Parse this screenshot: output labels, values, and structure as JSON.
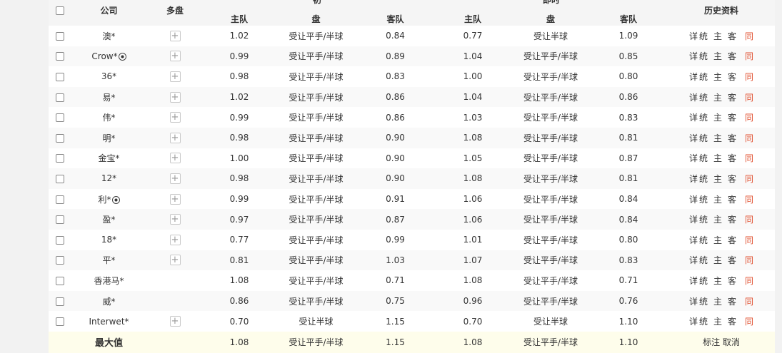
{
  "header": {
    "company": "公司",
    "multi": "多盘",
    "initial_group": "初",
    "live_group": "即时",
    "home": "主队",
    "pan": "盘",
    "away": "客队",
    "history": "历史资料"
  },
  "history_links": {
    "detail": "详",
    "stats": "统",
    "home": "主",
    "away": "客",
    "same": "同"
  },
  "colors": {
    "accent_same": "#e04b2a",
    "max_row_bg": "#fefdeb",
    "header_bg": "#f5f5f5"
  },
  "rows": [
    {
      "company": "澳*",
      "ball": false,
      "multi": true,
      "init_home": "1.02",
      "init_pan": "受让平手/半球",
      "init_away": "0.84",
      "live_home": "0.77",
      "live_pan": "受让半球",
      "live_away": "1.09"
    },
    {
      "company": "Crow*",
      "ball": true,
      "multi": true,
      "init_home": "0.99",
      "init_pan": "受让平手/半球",
      "init_away": "0.89",
      "live_home": "1.04",
      "live_pan": "受让平手/半球",
      "live_away": "0.85"
    },
    {
      "company": "36*",
      "ball": false,
      "multi": true,
      "init_home": "0.98",
      "init_pan": "受让平手/半球",
      "init_away": "0.83",
      "live_home": "1.00",
      "live_pan": "受让平手/半球",
      "live_away": "0.80"
    },
    {
      "company": "易*",
      "ball": false,
      "multi": true,
      "init_home": "1.02",
      "init_pan": "受让平手/半球",
      "init_away": "0.86",
      "live_home": "1.04",
      "live_pan": "受让平手/半球",
      "live_away": "0.86"
    },
    {
      "company": "伟*",
      "ball": false,
      "multi": true,
      "init_home": "0.99",
      "init_pan": "受让平手/半球",
      "init_away": "0.86",
      "live_home": "1.03",
      "live_pan": "受让平手/半球",
      "live_away": "0.83"
    },
    {
      "company": "明*",
      "ball": false,
      "multi": true,
      "init_home": "0.98",
      "init_pan": "受让平手/半球",
      "init_away": "0.90",
      "live_home": "1.08",
      "live_pan": "受让平手/半球",
      "live_away": "0.81"
    },
    {
      "company": "金宝*",
      "ball": false,
      "multi": true,
      "init_home": "1.00",
      "init_pan": "受让平手/半球",
      "init_away": "0.90",
      "live_home": "1.05",
      "live_pan": "受让平手/半球",
      "live_away": "0.87"
    },
    {
      "company": "12*",
      "ball": false,
      "multi": true,
      "init_home": "0.98",
      "init_pan": "受让平手/半球",
      "init_away": "0.90",
      "live_home": "1.08",
      "live_pan": "受让平手/半球",
      "live_away": "0.81"
    },
    {
      "company": "利*",
      "ball": true,
      "multi": true,
      "init_home": "0.99",
      "init_pan": "受让平手/半球",
      "init_away": "0.91",
      "live_home": "1.06",
      "live_pan": "受让平手/半球",
      "live_away": "0.84"
    },
    {
      "company": "盈*",
      "ball": false,
      "multi": true,
      "init_home": "0.97",
      "init_pan": "受让平手/半球",
      "init_away": "0.87",
      "live_home": "1.06",
      "live_pan": "受让平手/半球",
      "live_away": "0.84"
    },
    {
      "company": "18*",
      "ball": false,
      "multi": true,
      "init_home": "0.77",
      "init_pan": "受让平手/半球",
      "init_away": "0.99",
      "live_home": "1.01",
      "live_pan": "受让平手/半球",
      "live_away": "0.80"
    },
    {
      "company": "平*",
      "ball": false,
      "multi": true,
      "init_home": "0.81",
      "init_pan": "受让平手/半球",
      "init_away": "1.03",
      "live_home": "1.07",
      "live_pan": "受让平手/半球",
      "live_away": "0.83"
    },
    {
      "company": "香港马*",
      "ball": false,
      "multi": false,
      "init_home": "1.08",
      "init_pan": "受让平手/半球",
      "init_away": "0.71",
      "live_home": "1.08",
      "live_pan": "受让平手/半球",
      "live_away": "0.71"
    },
    {
      "company": "威*",
      "ball": false,
      "multi": false,
      "init_home": "0.86",
      "init_pan": "受让平手/半球",
      "init_away": "0.75",
      "live_home": "0.96",
      "live_pan": "受让平手/半球",
      "live_away": "0.76"
    },
    {
      "company": "Interwet*",
      "ball": false,
      "multi": true,
      "init_home": "0.70",
      "init_pan": "受让半球",
      "init_away": "1.15",
      "live_home": "0.70",
      "live_pan": "受让半球",
      "live_away": "1.10"
    }
  ],
  "max_row": {
    "label": "最大值",
    "init_home": "1.08",
    "init_pan": "受让平手/半球",
    "init_away": "1.15",
    "live_home": "1.08",
    "live_pan": "受让平手/半球",
    "live_away": "1.10",
    "mark": "标注",
    "cancel": "取消"
  }
}
